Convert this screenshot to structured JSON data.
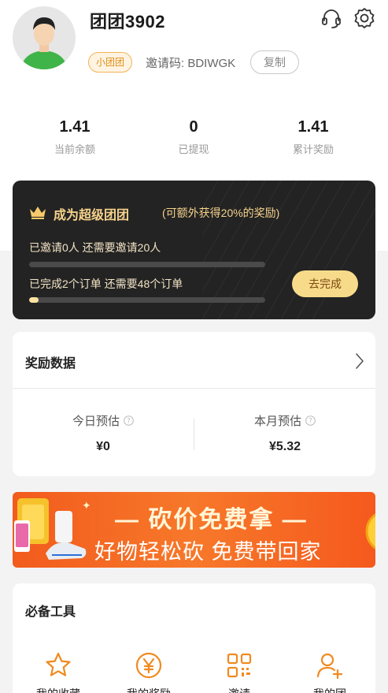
{
  "profile": {
    "username": "团团3902",
    "tag": "小团团",
    "invite_code": "邀请码: BDIWGK",
    "copy_label": "复制"
  },
  "stats": [
    {
      "value": "1.41",
      "label": "当前余额"
    },
    {
      "value": "0",
      "label": "已提现"
    },
    {
      "value": "1.41",
      "label": "累计奖励"
    }
  ],
  "promo": {
    "title": "成为超级团团",
    "subtitle": "(可额外获得20%的奖励)",
    "invite_progress_text": "已邀请0人  还需要邀请20人",
    "invite_progress": 0.0,
    "order_progress_text": "已完成2个订单  还需要48个订单",
    "order_progress": 0.04,
    "action_label": "去完成"
  },
  "rewards": {
    "title": "奖励数据",
    "today_label": "今日预估",
    "today_value": "¥0",
    "month_label": "本月预估",
    "month_value": "¥5.32"
  },
  "banner": {
    "line1": "— 砍价免费拿 —",
    "line2": "好物轻松砍 免费带回家"
  },
  "tools": {
    "title": "必备工具",
    "items": [
      {
        "label": "我的收藏",
        "icon": "star-icon"
      },
      {
        "label": "我的奖励",
        "icon": "yen-icon"
      },
      {
        "label": "邀请",
        "icon": "qr-code-icon"
      },
      {
        "label": "我的团",
        "icon": "add-user-icon"
      }
    ]
  },
  "colors": {
    "accent": "#f29c1f",
    "gold": "#f7d38c",
    "dark_card": "#232323",
    "banner_orange": "#f25b1d"
  }
}
